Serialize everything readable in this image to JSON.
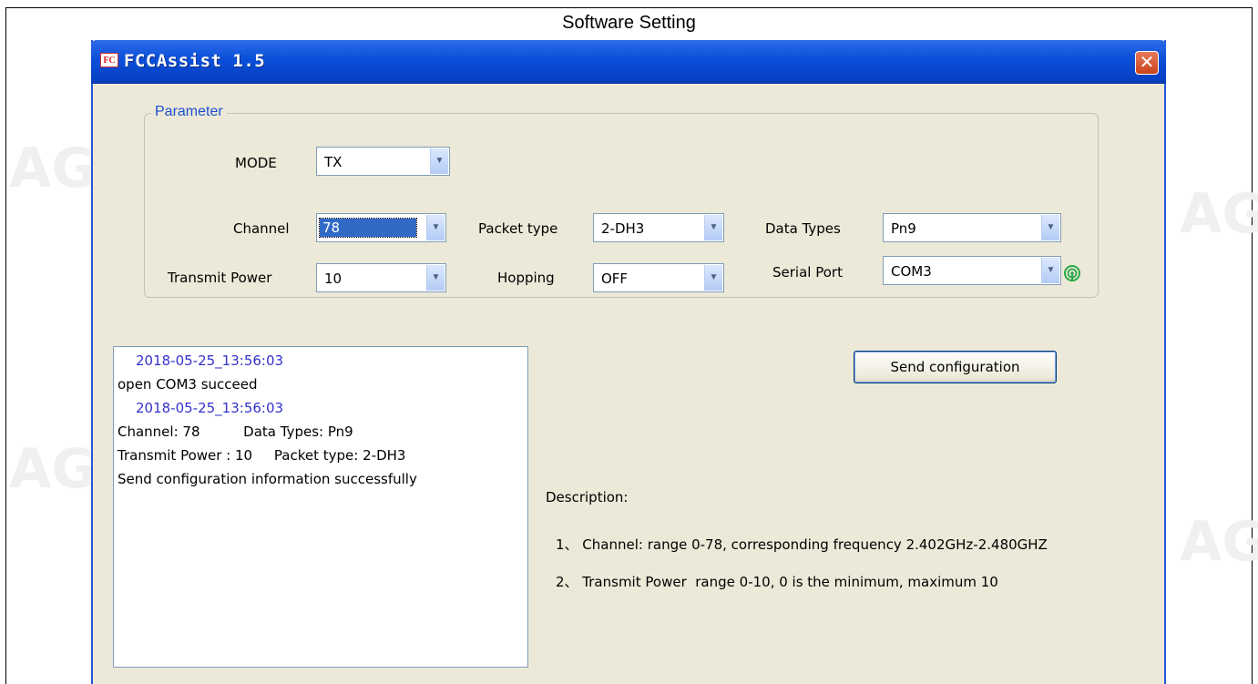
{
  "page": {
    "title": "Software Setting"
  },
  "window": {
    "title": "FCCAssist 1.5",
    "icon": "app-icon",
    "close_symbol": "✕"
  },
  "parameter": {
    "legend": "Parameter",
    "mode": {
      "label": "MODE",
      "value": "TX"
    },
    "channel": {
      "label": "Channel",
      "value": "78"
    },
    "packet_type": {
      "label": "Packet type",
      "value": "2-DH3"
    },
    "data_types": {
      "label": "Data Types",
      "value": "Pn9"
    },
    "transmit_power": {
      "label": "Transmit Power",
      "value": "10"
    },
    "hopping": {
      "label": "Hopping",
      "value": "OFF"
    },
    "serial_port": {
      "label": "Serial Port",
      "value": "COM3",
      "status_icon": "signal-icon"
    }
  },
  "log": [
    {
      "text": "2018-05-25_13:56:03",
      "kind": "timestamp"
    },
    {
      "text": "open COM3 succeed",
      "kind": "message"
    },
    {
      "text": "2018-05-25_13:56:03",
      "kind": "timestamp"
    },
    {
      "text": "Channel: 78          Data Types: Pn9",
      "kind": "message"
    },
    {
      "text": "Transmit Power : 10     Packet type: 2-DH3",
      "kind": "message"
    },
    {
      "text": "Send configuration information successfully",
      "kind": "message"
    }
  ],
  "send_button": {
    "label": "Send configuration"
  },
  "description": {
    "heading": "Description:",
    "items": [
      "1、 Channel: range 0-78, corresponding frequency 2.402GHz-2.480GHZ",
      "2、 Transmit Power  range 0-10, 0 is the minimum, maximum 10"
    ]
  },
  "colors": {
    "titlebar": "#0a4fd9",
    "window_bg": "#ece9d8",
    "timestamp": "#3333cc",
    "selection": "#316ac5"
  }
}
